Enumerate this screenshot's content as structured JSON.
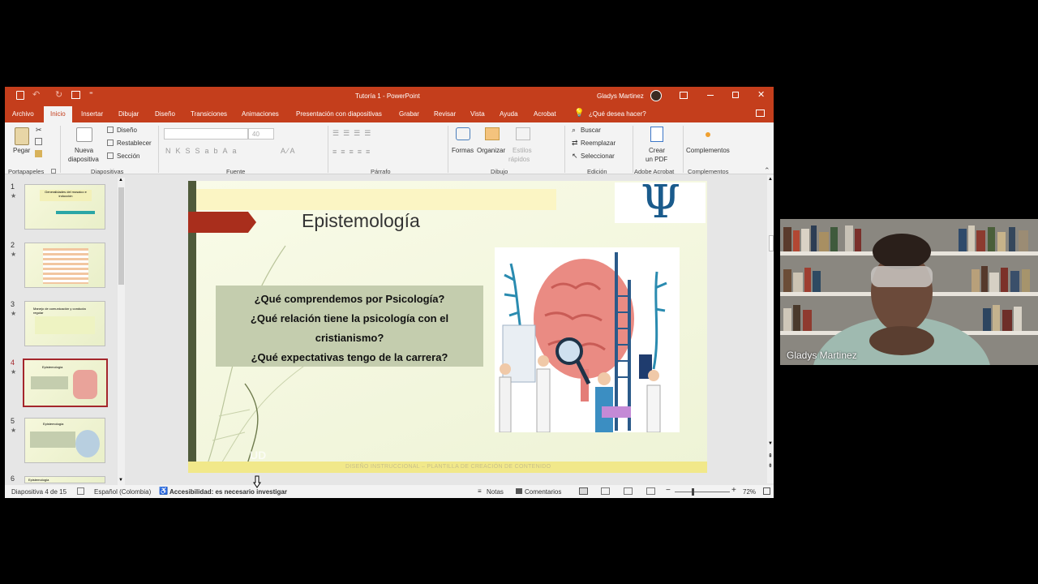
{
  "titlebar": {
    "doc_title": "Tutoría 1  -  PowerPoint",
    "user_name": "Gladys Martinez"
  },
  "menu": {
    "items": [
      "Archivo",
      "Inicio",
      "Insertar",
      "Dibujar",
      "Diseño",
      "Transiciones",
      "Animaciones",
      "Presentación con diapositivas",
      "Grabar",
      "Revisar",
      "Vista",
      "Ayuda",
      "Acrobat"
    ],
    "active": "Inicio",
    "tell_me": "¿Qué desea hacer?"
  },
  "ribbon": {
    "pegar": "Pegar",
    "nueva": "Nueva",
    "diapositiva": "diapositiva",
    "diseno": "Diseño",
    "restablecer": "Restablecer",
    "seccion": "Sección",
    "font_size": "40",
    "formas": "Formas",
    "organizar": "Organizar",
    "estilos": "Estilos",
    "rapidos": "rápidos",
    "buscar": "Buscar",
    "reemplazar": "Reemplazar",
    "seleccionar": "Seleccionar",
    "crear": "Crear",
    "un_pdf": "un PDF",
    "complementos": "Complementos",
    "groups": {
      "portapapeles": "Portapapeles",
      "diapositivas": "Diapositivas",
      "fuente": "Fuente",
      "parrafo": "Párrafo",
      "dibujo": "Dibujo",
      "edicion": "Edición",
      "adobe": "Adobe Acrobat",
      "complementos": "Complementos"
    }
  },
  "thumbnails": [
    {
      "num": "1",
      "title": "Generalidades del mosaico e inducción"
    },
    {
      "num": "2",
      "title": ""
    },
    {
      "num": "3",
      "title": "Manejo de comunicación y conducta regular"
    },
    {
      "num": "4",
      "title": "Epistemología"
    },
    {
      "num": "5",
      "title": "Epistemología"
    },
    {
      "num": "6",
      "title": "Epistemología"
    }
  ],
  "slide": {
    "title": "Epistemología",
    "q1": "¿Qué comprendemos por Psicología?",
    "q2": "¿Qué relación tiene la psicología con el",
    "q3": "cristianismo?",
    "q4": "¿Qué expectativas tengo de la carrera?",
    "footer": "DISEÑO INSTRUCCIONAL – PLANTILLA DE CREACIÓN DE CONTENIDO",
    "logo_symbol": "Ψ"
  },
  "status": {
    "slide_info": "Diapositiva 4 de 15",
    "language": "Español (Colombia)",
    "accessibility": "Accesibilidad: es necesario investigar",
    "notes": "Notas",
    "comments": "Comentarios",
    "zoom": "72%"
  },
  "video": {
    "participant": "Gladys Martinez"
  },
  "colors": {
    "ppt_accent": "#c43e1c",
    "slide_bg": "#f4f7e0",
    "question_box": "#c4cdae",
    "selected_thumb": "#a4262c"
  }
}
